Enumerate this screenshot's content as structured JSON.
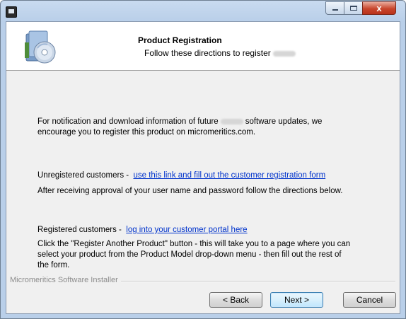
{
  "window": {
    "title": "",
    "controls": {
      "minimize": "",
      "maximize": "",
      "close": "x"
    }
  },
  "header": {
    "title": "Product Registration",
    "subtitle_prefix": "Follow these directions to register"
  },
  "body": {
    "intro_prefix": "For notification and download information of future",
    "intro_suffix": "software updates, we",
    "intro_line2": "encourage you to register this product on micromeritics.com.",
    "unregistered_label": "Unregistered customers -",
    "unregistered_link": "use this link and fill out the customer registration form",
    "unregistered_note": "After receiving approval of your user name and password follow the directions below.",
    "registered_label": "Registered customers -",
    "registered_link": "log into your customer portal here",
    "registered_note_1": "Click the \"Register Another Product\" button - this will take you to a page where you can",
    "registered_note_2": "select your product from the Product Model drop-down menu - then fill out the rest of",
    "registered_note_3": "the form."
  },
  "footer": {
    "installer_label": "Micromeritics Software Installer",
    "back": "< Back",
    "next": "Next >",
    "cancel": "Cancel"
  },
  "icons": [
    "app-icon",
    "installer-disc-icon",
    "minimize-icon",
    "maximize-icon",
    "close-icon"
  ]
}
